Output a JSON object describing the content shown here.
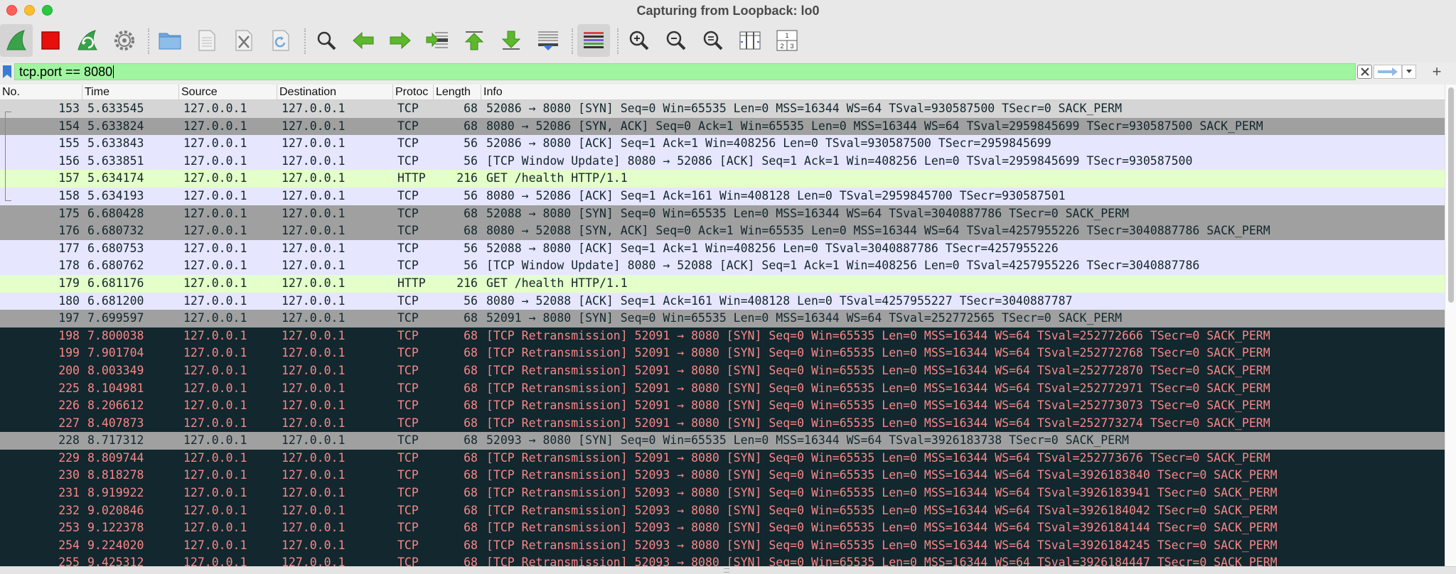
{
  "window": {
    "title": "Capturing from Loopback: lo0"
  },
  "toolbar": {
    "buttons": [
      {
        "name": "start-capture-button",
        "icon": "shark-fin-icon"
      },
      {
        "name": "stop-capture-button",
        "icon": "stop-square-icon"
      },
      {
        "name": "restart-capture-button",
        "icon": "restart-fin-icon"
      },
      {
        "name": "capture-options-button",
        "icon": "gear-icon"
      },
      {
        "name": "open-file-button",
        "icon": "folder-icon"
      },
      {
        "name": "save-file-button",
        "icon": "document-icon"
      },
      {
        "name": "close-file-button",
        "icon": "close-file-icon"
      },
      {
        "name": "reload-file-button",
        "icon": "reload-icon"
      },
      {
        "name": "find-packet-button",
        "icon": "magnifier-icon"
      },
      {
        "name": "go-back-button",
        "icon": "arrow-left-icon"
      },
      {
        "name": "go-forward-button",
        "icon": "arrow-right-icon"
      },
      {
        "name": "go-to-packet-button",
        "icon": "jump-to-icon"
      },
      {
        "name": "go-first-packet-button",
        "icon": "arrow-up-icon"
      },
      {
        "name": "go-last-packet-button",
        "icon": "arrow-down-icon"
      },
      {
        "name": "autoscroll-button",
        "icon": "autoscroll-icon"
      },
      {
        "name": "colorize-button",
        "icon": "colorize-icon"
      },
      {
        "name": "zoom-in-button",
        "icon": "zoom-in-icon"
      },
      {
        "name": "zoom-out-button",
        "icon": "zoom-out-icon"
      },
      {
        "name": "normal-size-button",
        "icon": "zoom-normal-icon"
      },
      {
        "name": "resize-columns-button",
        "icon": "resize-columns-icon"
      }
    ],
    "layout_pane_labels": {
      "top": "1",
      "bottom_left": "2",
      "bottom_right": "3"
    }
  },
  "filter": {
    "value": "tcp.port == 8080"
  },
  "columns": [
    "No.",
    "Time",
    "Source",
    "Destination",
    "Protoc",
    "Length",
    "Info"
  ],
  "colors": {
    "normal_bg": "#e7e6ff",
    "normal_fg": "#12272e",
    "http_bg": "#e4ffc7",
    "syn_bg": "#a0a0a0",
    "syn_fg": "#12272e",
    "first_bg": "#d5d5d5",
    "bad_bg": "#12272e",
    "bad_fg": "#f78787"
  },
  "packets": [
    {
      "no": "153",
      "time": "5.633545",
      "src": "127.0.0.1",
      "dst": "127.0.0.1",
      "proto": "TCP",
      "len": "68",
      "info": "52086 → 8080 [SYN] Seq=0 Win=65535 Len=0 MSS=16344 WS=64 TSval=930587500 TSecr=0 SACK_PERM",
      "style": "first"
    },
    {
      "no": "154",
      "time": "5.633824",
      "src": "127.0.0.1",
      "dst": "127.0.0.1",
      "proto": "TCP",
      "len": "68",
      "info": "8080 → 52086 [SYN, ACK] Seq=0 Ack=1 Win=65535 Len=0 MSS=16344 WS=64 TSval=2959845699 TSecr=930587500 SACK_PERM",
      "style": "syn"
    },
    {
      "no": "155",
      "time": "5.633843",
      "src": "127.0.0.1",
      "dst": "127.0.0.1",
      "proto": "TCP",
      "len": "56",
      "info": "52086 → 8080 [ACK] Seq=1 Ack=1 Win=408256 Len=0 TSval=930587500 TSecr=2959845699",
      "style": "normal"
    },
    {
      "no": "156",
      "time": "5.633851",
      "src": "127.0.0.1",
      "dst": "127.0.0.1",
      "proto": "TCP",
      "len": "56",
      "info": "[TCP Window Update] 8080 → 52086 [ACK] Seq=1 Ack=1 Win=408256 Len=0 TSval=2959845699 TSecr=930587500",
      "style": "normal"
    },
    {
      "no": "157",
      "time": "5.634174",
      "src": "127.0.0.1",
      "dst": "127.0.0.1",
      "proto": "HTTP",
      "len": "216",
      "info": "GET /health HTTP/1.1",
      "style": "http"
    },
    {
      "no": "158",
      "time": "5.634193",
      "src": "127.0.0.1",
      "dst": "127.0.0.1",
      "proto": "TCP",
      "len": "56",
      "info": "8080 → 52086 [ACK] Seq=1 Ack=161 Win=408128 Len=0 TSval=2959845700 TSecr=930587501",
      "style": "normal"
    },
    {
      "no": "175",
      "time": "6.680428",
      "src": "127.0.0.1",
      "dst": "127.0.0.1",
      "proto": "TCP",
      "len": "68",
      "info": "52088 → 8080 [SYN] Seq=0 Win=65535 Len=0 MSS=16344 WS=64 TSval=3040887786 TSecr=0 SACK_PERM",
      "style": "syn"
    },
    {
      "no": "176",
      "time": "6.680732",
      "src": "127.0.0.1",
      "dst": "127.0.0.1",
      "proto": "TCP",
      "len": "68",
      "info": "8080 → 52088 [SYN, ACK] Seq=0 Ack=1 Win=65535 Len=0 MSS=16344 WS=64 TSval=4257955226 TSecr=3040887786 SACK_PERM",
      "style": "syn"
    },
    {
      "no": "177",
      "time": "6.680753",
      "src": "127.0.0.1",
      "dst": "127.0.0.1",
      "proto": "TCP",
      "len": "56",
      "info": "52088 → 8080 [ACK] Seq=1 Ack=1 Win=408256 Len=0 TSval=3040887786 TSecr=4257955226",
      "style": "normal"
    },
    {
      "no": "178",
      "time": "6.680762",
      "src": "127.0.0.1",
      "dst": "127.0.0.1",
      "proto": "TCP",
      "len": "56",
      "info": "[TCP Window Update] 8080 → 52088 [ACK] Seq=1 Ack=1 Win=408256 Len=0 TSval=4257955226 TSecr=3040887786",
      "style": "normal"
    },
    {
      "no": "179",
      "time": "6.681176",
      "src": "127.0.0.1",
      "dst": "127.0.0.1",
      "proto": "HTTP",
      "len": "216",
      "info": "GET /health HTTP/1.1",
      "style": "http"
    },
    {
      "no": "180",
      "time": "6.681200",
      "src": "127.0.0.1",
      "dst": "127.0.0.1",
      "proto": "TCP",
      "len": "56",
      "info": "8080 → 52088 [ACK] Seq=1 Ack=161 Win=408128 Len=0 TSval=4257955227 TSecr=3040887787",
      "style": "normal"
    },
    {
      "no": "197",
      "time": "7.699597",
      "src": "127.0.0.1",
      "dst": "127.0.0.1",
      "proto": "TCP",
      "len": "68",
      "info": "52091 → 8080 [SYN] Seq=0 Win=65535 Len=0 MSS=16344 WS=64 TSval=252772565 TSecr=0 SACK_PERM",
      "style": "syn"
    },
    {
      "no": "198",
      "time": "7.800038",
      "src": "127.0.0.1",
      "dst": "127.0.0.1",
      "proto": "TCP",
      "len": "68",
      "info": "[TCP Retransmission] 52091 → 8080 [SYN] Seq=0 Win=65535 Len=0 MSS=16344 WS=64 TSval=252772666 TSecr=0 SACK_PERM",
      "style": "bad"
    },
    {
      "no": "199",
      "time": "7.901704",
      "src": "127.0.0.1",
      "dst": "127.0.0.1",
      "proto": "TCP",
      "len": "68",
      "info": "[TCP Retransmission] 52091 → 8080 [SYN] Seq=0 Win=65535 Len=0 MSS=16344 WS=64 TSval=252772768 TSecr=0 SACK_PERM",
      "style": "bad"
    },
    {
      "no": "200",
      "time": "8.003349",
      "src": "127.0.0.1",
      "dst": "127.0.0.1",
      "proto": "TCP",
      "len": "68",
      "info": "[TCP Retransmission] 52091 → 8080 [SYN] Seq=0 Win=65535 Len=0 MSS=16344 WS=64 TSval=252772870 TSecr=0 SACK_PERM",
      "style": "bad"
    },
    {
      "no": "225",
      "time": "8.104981",
      "src": "127.0.0.1",
      "dst": "127.0.0.1",
      "proto": "TCP",
      "len": "68",
      "info": "[TCP Retransmission] 52091 → 8080 [SYN] Seq=0 Win=65535 Len=0 MSS=16344 WS=64 TSval=252772971 TSecr=0 SACK_PERM",
      "style": "bad"
    },
    {
      "no": "226",
      "time": "8.206612",
      "src": "127.0.0.1",
      "dst": "127.0.0.1",
      "proto": "TCP",
      "len": "68",
      "info": "[TCP Retransmission] 52091 → 8080 [SYN] Seq=0 Win=65535 Len=0 MSS=16344 WS=64 TSval=252773073 TSecr=0 SACK_PERM",
      "style": "bad"
    },
    {
      "no": "227",
      "time": "8.407873",
      "src": "127.0.0.1",
      "dst": "127.0.0.1",
      "proto": "TCP",
      "len": "68",
      "info": "[TCP Retransmission] 52091 → 8080 [SYN] Seq=0 Win=65535 Len=0 MSS=16344 WS=64 TSval=252773274 TSecr=0 SACK_PERM",
      "style": "bad"
    },
    {
      "no": "228",
      "time": "8.717312",
      "src": "127.0.0.1",
      "dst": "127.0.0.1",
      "proto": "TCP",
      "len": "68",
      "info": "52093 → 8080 [SYN] Seq=0 Win=65535 Len=0 MSS=16344 WS=64 TSval=3926183738 TSecr=0 SACK_PERM",
      "style": "syn"
    },
    {
      "no": "229",
      "time": "8.809744",
      "src": "127.0.0.1",
      "dst": "127.0.0.1",
      "proto": "TCP",
      "len": "68",
      "info": "[TCP Retransmission] 52091 → 8080 [SYN] Seq=0 Win=65535 Len=0 MSS=16344 WS=64 TSval=252773676 TSecr=0 SACK_PERM",
      "style": "bad"
    },
    {
      "no": "230",
      "time": "8.818278",
      "src": "127.0.0.1",
      "dst": "127.0.0.1",
      "proto": "TCP",
      "len": "68",
      "info": "[TCP Retransmission] 52093 → 8080 [SYN] Seq=0 Win=65535 Len=0 MSS=16344 WS=64 TSval=3926183840 TSecr=0 SACK_PERM",
      "style": "bad"
    },
    {
      "no": "231",
      "time": "8.919922",
      "src": "127.0.0.1",
      "dst": "127.0.0.1",
      "proto": "TCP",
      "len": "68",
      "info": "[TCP Retransmission] 52093 → 8080 [SYN] Seq=0 Win=65535 Len=0 MSS=16344 WS=64 TSval=3926183941 TSecr=0 SACK_PERM",
      "style": "bad"
    },
    {
      "no": "232",
      "time": "9.020846",
      "src": "127.0.0.1",
      "dst": "127.0.0.1",
      "proto": "TCP",
      "len": "68",
      "info": "[TCP Retransmission] 52093 → 8080 [SYN] Seq=0 Win=65535 Len=0 MSS=16344 WS=64 TSval=3926184042 TSecr=0 SACK_PERM",
      "style": "bad"
    },
    {
      "no": "253",
      "time": "9.122378",
      "src": "127.0.0.1",
      "dst": "127.0.0.1",
      "proto": "TCP",
      "len": "68",
      "info": "[TCP Retransmission] 52093 → 8080 [SYN] Seq=0 Win=65535 Len=0 MSS=16344 WS=64 TSval=3926184144 TSecr=0 SACK_PERM",
      "style": "bad"
    },
    {
      "no": "254",
      "time": "9.224020",
      "src": "127.0.0.1",
      "dst": "127.0.0.1",
      "proto": "TCP",
      "len": "68",
      "info": "[TCP Retransmission] 52093 → 8080 [SYN] Seq=0 Win=65535 Len=0 MSS=16344 WS=64 TSval=3926184245 TSecr=0 SACK_PERM",
      "style": "bad"
    },
    {
      "no": "255",
      "time": "9.425312",
      "src": "127.0.0.1",
      "dst": "127.0.0.1",
      "proto": "TCP",
      "len": "68",
      "info": "[TCP Retransmission] 52093 → 8080 [SYN] Seq=0 Win=65535 Len=0 MSS=16344 WS=64 TSval=3926184447 TSecr=0 SACK_PERM",
      "style": "bad"
    }
  ]
}
